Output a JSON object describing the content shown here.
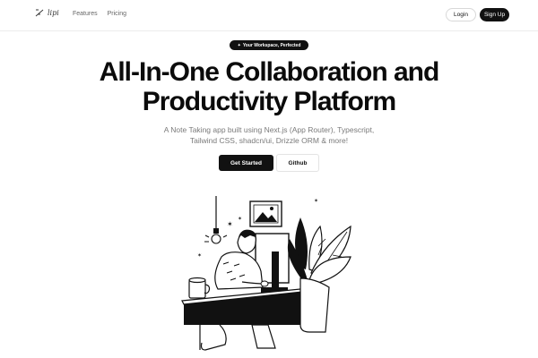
{
  "nav": {
    "logo_text": "lipi",
    "links": [
      "Features",
      "Pricing"
    ],
    "login_label": "Login",
    "signup_label": "Sign Up"
  },
  "hero": {
    "badge_icon": "sparkle-icon",
    "badge_label": "Your Workspace, Perfected",
    "title_line1": "All-In-One Collaboration and",
    "title_line2": "Productivity Platform",
    "subtitle_line1": "A Note Taking app built using Next.js (App Router), Typescript,",
    "subtitle_line2": "Tailwind CSS, shadcn/ui, Drizzle ORM & more!",
    "primary_cta": "Get Started",
    "secondary_cta": "Github"
  },
  "colors": {
    "primary": "#111111",
    "muted_text": "#7a7a7a",
    "border": "#e3e3e3",
    "background": "#ffffff"
  },
  "illustration": {
    "icon": "person-at-desk-illustration"
  }
}
